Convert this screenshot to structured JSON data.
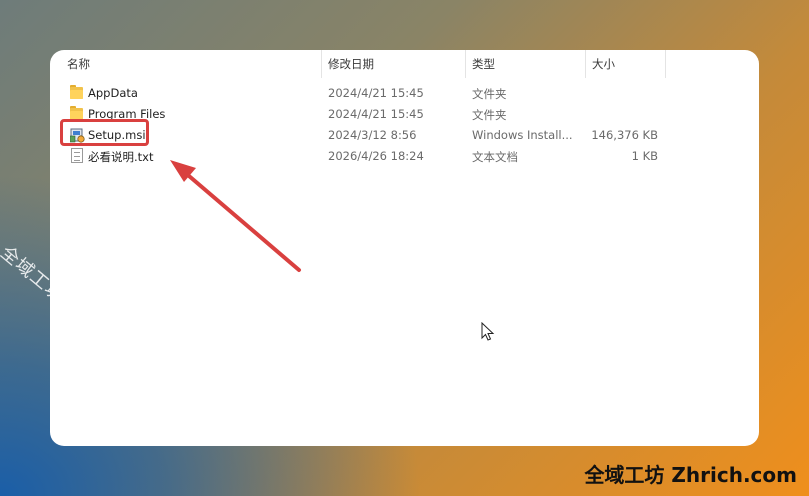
{
  "columns": {
    "name": "名称",
    "date": "修改日期",
    "type": "类型",
    "size": "大小"
  },
  "files": [
    {
      "name": "AppData",
      "date": "2024/4/21 15:45",
      "type": "文件夹",
      "size": "",
      "icon": "folder-icon"
    },
    {
      "name": "Program Files",
      "date": "2024/4/21 15:45",
      "type": "文件夹",
      "size": "",
      "icon": "folder-icon"
    },
    {
      "name": "Setup.msi",
      "date": "2024/3/12 8:56",
      "type": "Windows Install...",
      "size": "146,376 KB",
      "icon": "installer-icon"
    },
    {
      "name": "必看说明.txt",
      "date": "2026/4/26 18:24",
      "type": "文本文档",
      "size": "1 KB",
      "icon": "text-file-icon"
    }
  ],
  "watermark": "全域工坊 zhrich.com",
  "brand": "全域工坊 Zhrich.com",
  "colors": {
    "highlight": "#d9403f",
    "arrow": "#d9403f"
  }
}
